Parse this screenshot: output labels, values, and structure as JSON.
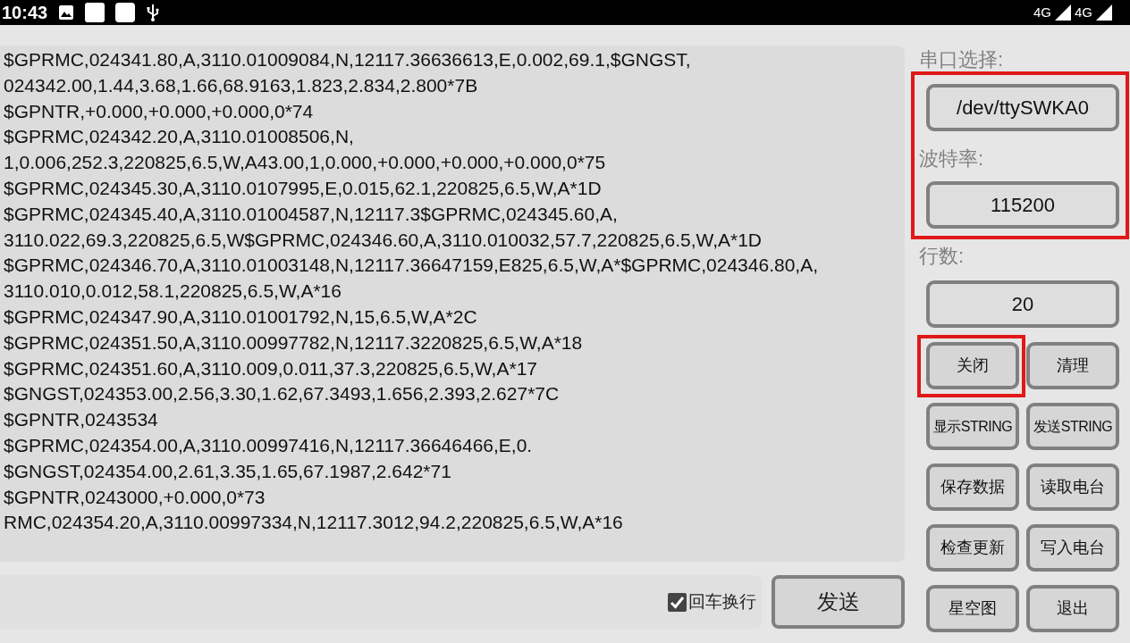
{
  "status_bar": {
    "time": "10:43",
    "networks": [
      "4G",
      "4G"
    ]
  },
  "log": {
    "lines": [
      "$GPRMC,024341.80,A,3110.01009084,N,12117.36636613,E,0.002,69.1,$GNGST,",
      "024342.00,1.44,3.68,1.66,68.9163,1.823,2.834,2.800*7B",
      "$GPNTR,+0.000,+0.000,+0.000,0*74",
      "$GPRMC,024342.20,A,3110.01008506,N,",
      "1,0.006,252.3,220825,6.5,W,A43.00,1,0.000,+0.000,+0.000,+0.000,0*75",
      "$GPRMC,024345.30,A,3110.0107995,E,0.015,62.1,220825,6.5,W,A*1D",
      "$GPRMC,024345.40,A,3110.01004587,N,12117.3$GPRMC,024345.60,A,",
      "3110.022,69.3,220825,6.5,W$GPRMC,024346.60,A,3110.010032,57.7,220825,6.5,W,A*1D",
      "$GPRMC,024346.70,A,3110.01003148,N,12117.36647159,E825,6.5,W,A*$GPRMC,024346.80,A,",
      "3110.010,0.012,58.1,220825,6.5,W,A*16",
      "$GPRMC,024347.90,A,3110.01001792,N,15,6.5,W,A*2C",
      "$GPRMC,024351.50,A,3110.00997782,N,12117.3220825,6.5,W,A*18",
      "$GPRMC,024351.60,A,3110.009,0.011,37.3,220825,6.5,W,A*17",
      "$GNGST,024353.00,2.56,3.30,1.62,67.3493,1.656,2.393,2.627*7C",
      "$GPNTR,0243534",
      "$GPRMC,024354.00,A,3110.00997416,N,12117.36646466,E,0.",
      "$GNGST,024354.00,2.61,3.35,1.65,67.1987,2.642*71",
      "$GPNTR,0243000,+0.000,0*73",
      "RMC,024354.20,A,3110.00997334,N,12117.3012,94.2,220825,6.5,W,A*16"
    ]
  },
  "send_bar": {
    "newline_checkbox": {
      "label": "回车换行",
      "checked": true
    },
    "send_button": "发送"
  },
  "settings": {
    "highlighted": true,
    "port_label": "串口选择:",
    "port": "/dev/ttySWKA0",
    "baud_label": "波特率:",
    "baud": "115200"
  },
  "rows_label": "行数:",
  "rows": "20",
  "buttons": [
    {
      "label": "关闭",
      "highlighted": true
    },
    {
      "label": "清理",
      "highlighted": false
    },
    {
      "label": "显示STRING",
      "highlighted": false
    },
    {
      "label": "发送STRING",
      "highlighted": false
    },
    {
      "label": "保存数据",
      "highlighted": false
    },
    {
      "label": "读取电台",
      "highlighted": false
    },
    {
      "label": "检查更新",
      "highlighted": false
    },
    {
      "label": "写入电台",
      "highlighted": false
    },
    {
      "label": "星空图",
      "highlighted": false
    },
    {
      "label": "退出",
      "highlighted": false
    }
  ]
}
